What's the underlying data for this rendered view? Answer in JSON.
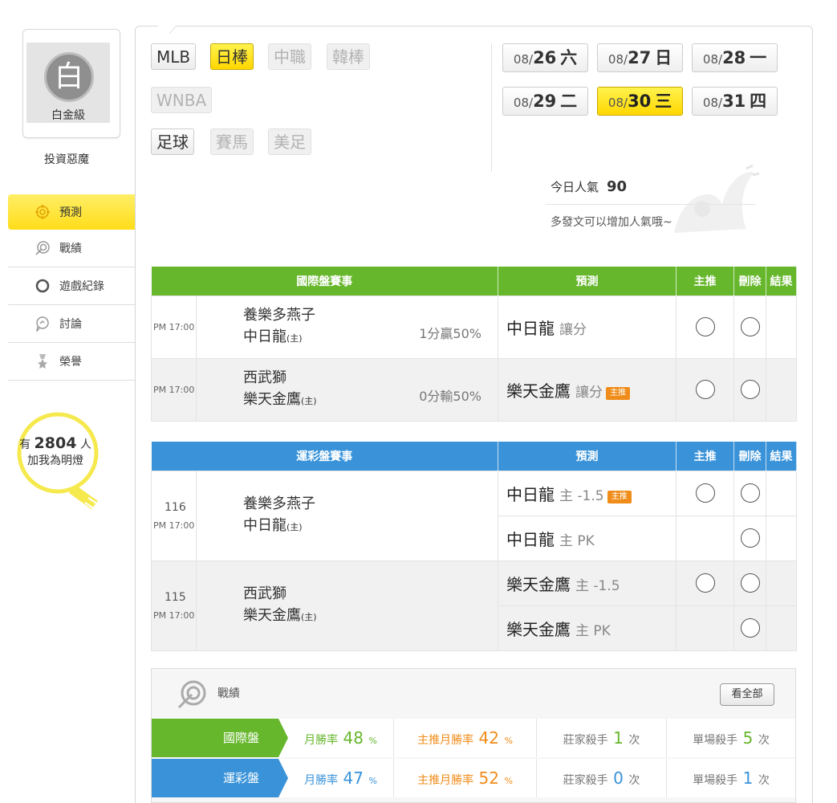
{
  "profile": {
    "avatar_char": "白",
    "level": "白金級",
    "username": "投資惡魔"
  },
  "nav": [
    {
      "label": "預測",
      "icon": "target-icon",
      "active": true
    },
    {
      "label": "戰績",
      "icon": "record-target-icon"
    },
    {
      "label": "遊戲紀錄",
      "icon": "circle-icon"
    },
    {
      "label": "討論",
      "icon": "chat-icon"
    },
    {
      "label": "榮譽",
      "icon": "medal-icon"
    }
  ],
  "fans": {
    "prefix": "有",
    "count": "2804",
    "suffix": "人",
    "line2": "加我為明燈"
  },
  "leagues": [
    {
      "label": "MLB",
      "state": "normal"
    },
    {
      "label": "日棒",
      "state": "on"
    },
    {
      "label": "中職",
      "state": "off"
    },
    {
      "label": "韓棒",
      "state": "off"
    },
    {
      "label": "WNBA",
      "state": "off"
    },
    {
      "label": "足球",
      "state": "normal"
    },
    {
      "label": "賽馬",
      "state": "off"
    },
    {
      "label": "美足",
      "state": "off"
    }
  ],
  "dates": [
    {
      "md": "08/",
      "day": "26",
      "wd": "六",
      "on": false
    },
    {
      "md": "08/",
      "day": "27",
      "wd": "日",
      "on": false
    },
    {
      "md": "08/",
      "day": "28",
      "wd": "一",
      "on": false
    },
    {
      "md": "08/",
      "day": "29",
      "wd": "二",
      "on": false
    },
    {
      "md": "08/",
      "day": "30",
      "wd": "三",
      "on": true
    },
    {
      "md": "08/",
      "day": "31",
      "wd": "四",
      "on": false
    }
  ],
  "popularity": {
    "label": "今日人氣",
    "value": "90",
    "hint": "多發文可以增加人氣哦~"
  },
  "intl": {
    "headers": {
      "event": "國際盤賽事",
      "pred": "預測",
      "main": "主推",
      "del": "刪除",
      "result": "結果"
    },
    "rows": [
      {
        "time": "PM 17:00",
        "away": "養樂多燕子",
        "home": "中日龍",
        "home_tag": "(主)",
        "odds": "1分贏50%",
        "pick": "中日龍",
        "type": "讓分",
        "featured": false
      },
      {
        "time": "PM 17:00",
        "away": "西武獅",
        "home": "樂天金鷹",
        "home_tag": "(主)",
        "odds": "0分輸50%",
        "pick": "樂天金鷹",
        "type": "讓分",
        "featured": true
      }
    ]
  },
  "lottery": {
    "headers": {
      "event": "運彩盤賽事",
      "pred": "預測",
      "main": "主推",
      "del": "刪除",
      "result": "結果"
    },
    "games": [
      {
        "num": "116",
        "time": "PM 17:00",
        "away": "養樂多燕子",
        "home": "中日龍",
        "home_tag": "(主)",
        "picks": [
          {
            "team": "中日龍",
            "type": "主 -1.5",
            "featured": true
          },
          {
            "team": "中日龍",
            "type": "主 PK",
            "featured": false
          }
        ]
      },
      {
        "num": "115",
        "time": "PM 17:00",
        "away": "西武獅",
        "home": "樂天金鷹",
        "home_tag": "(主)",
        "picks": [
          {
            "team": "樂天金鷹",
            "type": "主 -1.5",
            "featured": false
          },
          {
            "team": "樂天金鷹",
            "type": "主 PK",
            "featured": false
          }
        ]
      }
    ],
    "featured_tag": "主推"
  },
  "record": {
    "title": "戰績",
    "view_all": "看全部",
    "rows": [
      {
        "label": "國際盤",
        "month_label": "月勝率",
        "month": "48",
        "main_label": "主推月勝率",
        "main": "42",
        "pct": "%",
        "house_label": "莊家殺手",
        "house": "1",
        "single_label": "單場殺手",
        "single": "5",
        "times": "次"
      },
      {
        "label": "運彩盤",
        "month_label": "月勝率",
        "month": "47",
        "main_label": "主推月勝率",
        "main": "52",
        "pct": "%",
        "house_label": "莊家殺手",
        "house": "0",
        "single_label": "單場殺手",
        "single": "1",
        "times": "次"
      }
    ]
  },
  "colors": {
    "accent_yellow": "#ffd700",
    "green": "#67b72d",
    "blue": "#3a93d9",
    "orange": "#f08c1a"
  }
}
